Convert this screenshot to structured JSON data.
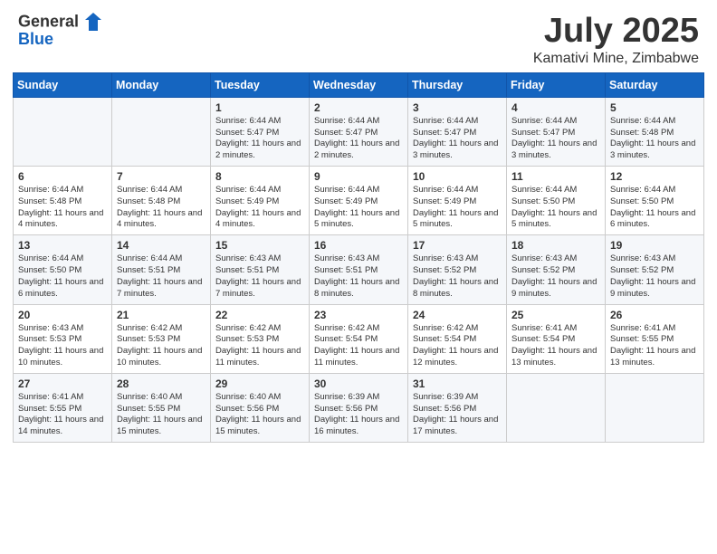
{
  "header": {
    "logo_general": "General",
    "logo_blue": "Blue",
    "month": "July 2025",
    "location": "Kamativi Mine, Zimbabwe"
  },
  "weekdays": [
    "Sunday",
    "Monday",
    "Tuesday",
    "Wednesday",
    "Thursday",
    "Friday",
    "Saturday"
  ],
  "weeks": [
    [
      {
        "day": "",
        "text": ""
      },
      {
        "day": "",
        "text": ""
      },
      {
        "day": "1",
        "text": "Sunrise: 6:44 AM\nSunset: 5:47 PM\nDaylight: 11 hours and 2 minutes."
      },
      {
        "day": "2",
        "text": "Sunrise: 6:44 AM\nSunset: 5:47 PM\nDaylight: 11 hours and 2 minutes."
      },
      {
        "day": "3",
        "text": "Sunrise: 6:44 AM\nSunset: 5:47 PM\nDaylight: 11 hours and 3 minutes."
      },
      {
        "day": "4",
        "text": "Sunrise: 6:44 AM\nSunset: 5:47 PM\nDaylight: 11 hours and 3 minutes."
      },
      {
        "day": "5",
        "text": "Sunrise: 6:44 AM\nSunset: 5:48 PM\nDaylight: 11 hours and 3 minutes."
      }
    ],
    [
      {
        "day": "6",
        "text": "Sunrise: 6:44 AM\nSunset: 5:48 PM\nDaylight: 11 hours and 4 minutes."
      },
      {
        "day": "7",
        "text": "Sunrise: 6:44 AM\nSunset: 5:48 PM\nDaylight: 11 hours and 4 minutes."
      },
      {
        "day": "8",
        "text": "Sunrise: 6:44 AM\nSunset: 5:49 PM\nDaylight: 11 hours and 4 minutes."
      },
      {
        "day": "9",
        "text": "Sunrise: 6:44 AM\nSunset: 5:49 PM\nDaylight: 11 hours and 5 minutes."
      },
      {
        "day": "10",
        "text": "Sunrise: 6:44 AM\nSunset: 5:49 PM\nDaylight: 11 hours and 5 minutes."
      },
      {
        "day": "11",
        "text": "Sunrise: 6:44 AM\nSunset: 5:50 PM\nDaylight: 11 hours and 5 minutes."
      },
      {
        "day": "12",
        "text": "Sunrise: 6:44 AM\nSunset: 5:50 PM\nDaylight: 11 hours and 6 minutes."
      }
    ],
    [
      {
        "day": "13",
        "text": "Sunrise: 6:44 AM\nSunset: 5:50 PM\nDaylight: 11 hours and 6 minutes."
      },
      {
        "day": "14",
        "text": "Sunrise: 6:44 AM\nSunset: 5:51 PM\nDaylight: 11 hours and 7 minutes."
      },
      {
        "day": "15",
        "text": "Sunrise: 6:43 AM\nSunset: 5:51 PM\nDaylight: 11 hours and 7 minutes."
      },
      {
        "day": "16",
        "text": "Sunrise: 6:43 AM\nSunset: 5:51 PM\nDaylight: 11 hours and 8 minutes."
      },
      {
        "day": "17",
        "text": "Sunrise: 6:43 AM\nSunset: 5:52 PM\nDaylight: 11 hours and 8 minutes."
      },
      {
        "day": "18",
        "text": "Sunrise: 6:43 AM\nSunset: 5:52 PM\nDaylight: 11 hours and 9 minutes."
      },
      {
        "day": "19",
        "text": "Sunrise: 6:43 AM\nSunset: 5:52 PM\nDaylight: 11 hours and 9 minutes."
      }
    ],
    [
      {
        "day": "20",
        "text": "Sunrise: 6:43 AM\nSunset: 5:53 PM\nDaylight: 11 hours and 10 minutes."
      },
      {
        "day": "21",
        "text": "Sunrise: 6:42 AM\nSunset: 5:53 PM\nDaylight: 11 hours and 10 minutes."
      },
      {
        "day": "22",
        "text": "Sunrise: 6:42 AM\nSunset: 5:53 PM\nDaylight: 11 hours and 11 minutes."
      },
      {
        "day": "23",
        "text": "Sunrise: 6:42 AM\nSunset: 5:54 PM\nDaylight: 11 hours and 11 minutes."
      },
      {
        "day": "24",
        "text": "Sunrise: 6:42 AM\nSunset: 5:54 PM\nDaylight: 11 hours and 12 minutes."
      },
      {
        "day": "25",
        "text": "Sunrise: 6:41 AM\nSunset: 5:54 PM\nDaylight: 11 hours and 13 minutes."
      },
      {
        "day": "26",
        "text": "Sunrise: 6:41 AM\nSunset: 5:55 PM\nDaylight: 11 hours and 13 minutes."
      }
    ],
    [
      {
        "day": "27",
        "text": "Sunrise: 6:41 AM\nSunset: 5:55 PM\nDaylight: 11 hours and 14 minutes."
      },
      {
        "day": "28",
        "text": "Sunrise: 6:40 AM\nSunset: 5:55 PM\nDaylight: 11 hours and 15 minutes."
      },
      {
        "day": "29",
        "text": "Sunrise: 6:40 AM\nSunset: 5:56 PM\nDaylight: 11 hours and 15 minutes."
      },
      {
        "day": "30",
        "text": "Sunrise: 6:39 AM\nSunset: 5:56 PM\nDaylight: 11 hours and 16 minutes."
      },
      {
        "day": "31",
        "text": "Sunrise: 6:39 AM\nSunset: 5:56 PM\nDaylight: 11 hours and 17 minutes."
      },
      {
        "day": "",
        "text": ""
      },
      {
        "day": "",
        "text": ""
      }
    ]
  ]
}
